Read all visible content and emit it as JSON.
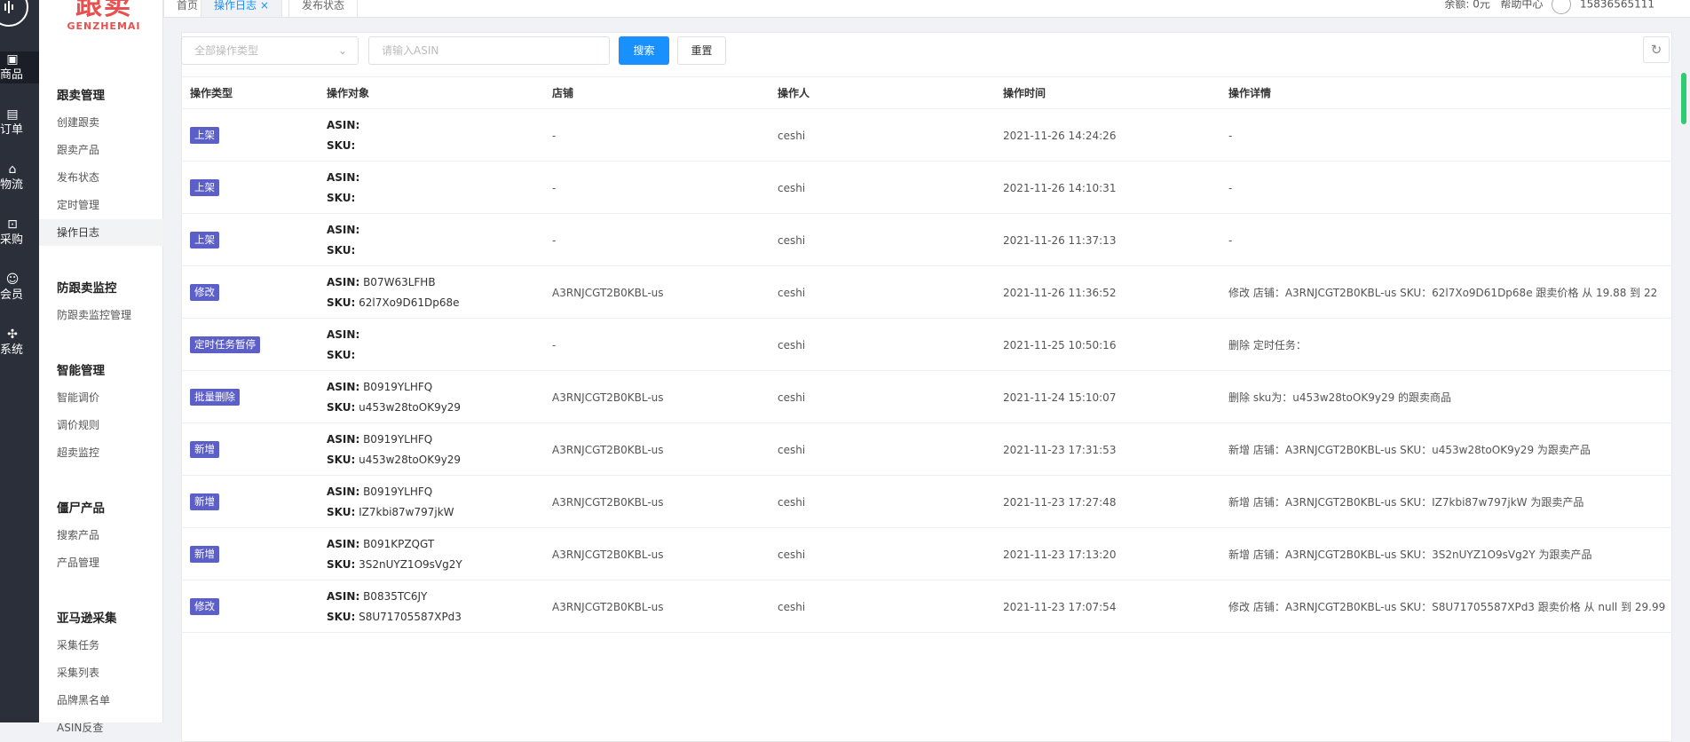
{
  "rail": {
    "items": [
      {
        "icon": "box-icon",
        "glyph": "▣",
        "label": "商品"
      },
      {
        "icon": "order-icon",
        "glyph": "▤",
        "label": "订单"
      },
      {
        "icon": "home-icon",
        "glyph": "⌂",
        "label": "物流"
      },
      {
        "icon": "cart-icon",
        "glyph": "⊡",
        "label": "采购"
      },
      {
        "icon": "user-icon",
        "glyph": "☺",
        "label": "会员"
      },
      {
        "icon": "puzzle-icon",
        "glyph": "✣",
        "label": "系统"
      }
    ]
  },
  "brand": {
    "cn": "跟卖",
    "en": "GENZHEMAI"
  },
  "sidebar": {
    "groups": [
      {
        "title": "跟卖管理",
        "items": [
          "创建跟卖",
          "跟卖产品",
          "发布状态",
          "定时管理",
          "操作日志"
        ]
      },
      {
        "title": "防跟卖监控",
        "items": [
          "防跟卖监控管理"
        ]
      },
      {
        "title": "智能管理",
        "items": [
          "智能调价",
          "调价规则",
          "超卖监控"
        ]
      },
      {
        "title": "僵尸产品",
        "items": [
          "搜索产品",
          "产品管理"
        ]
      },
      {
        "title": "亚马逊采集",
        "items": [
          "采集任务",
          "采集列表",
          "品牌黑名单",
          "ASIN反查"
        ]
      }
    ]
  },
  "tabs": [
    {
      "label": "首页"
    },
    {
      "label": "操作日志 ×"
    },
    {
      "label": "发布状态"
    }
  ],
  "topright": {
    "balance": "余额: 0元",
    "help": "帮助中心",
    "phone": "15836565111"
  },
  "filters": {
    "type_placeholder": "全部操作类型",
    "asin_placeholder": "请输入ASIN",
    "search_label": "搜索",
    "reset_label": "重置"
  },
  "table": {
    "headers": [
      "操作类型",
      "操作对象",
      "店铺",
      "操作人",
      "操作时间",
      "操作详情"
    ],
    "rows": [
      {
        "type": "上架",
        "asin": "",
        "sku": "",
        "shop": "-",
        "user": "ceshi",
        "time": "2021-11-26 14:24:26",
        "detail": "-"
      },
      {
        "type": "上架",
        "asin": "",
        "sku": "",
        "shop": "-",
        "user": "ceshi",
        "time": "2021-11-26 14:10:31",
        "detail": "-"
      },
      {
        "type": "上架",
        "asin": "",
        "sku": "",
        "shop": "-",
        "user": "ceshi",
        "time": "2021-11-26 11:37:13",
        "detail": "-"
      },
      {
        "type": "修改",
        "asin": "B07W63LFHB",
        "sku": "62l7Xo9D61Dp68e",
        "shop": "A3RNJCGT2B0KBL-us",
        "user": "ceshi",
        "time": "2021-11-26 11:36:52",
        "detail": "修改 店铺：A3RNJCGT2B0KBL-us SKU：62l7Xo9D61Dp68e 跟卖价格 从 19.88 到 22"
      },
      {
        "type": "定时任务暂停",
        "asin": "",
        "sku": "",
        "shop": "-",
        "user": "ceshi",
        "time": "2021-11-25 10:50:16",
        "detail": "删除 定时任务："
      },
      {
        "type": "批量删除",
        "asin": "B0919YLHFQ",
        "sku": "u453w28toOK9y29",
        "shop": "A3RNJCGT2B0KBL-us",
        "user": "ceshi",
        "time": "2021-11-24 15:10:07",
        "detail": "删除 sku为：u453w28toOK9y29 的跟卖商品"
      },
      {
        "type": "新增",
        "asin": "B0919YLHFQ",
        "sku": "u453w28toOK9y29",
        "shop": "A3RNJCGT2B0KBL-us",
        "user": "ceshi",
        "time": "2021-11-23 17:31:53",
        "detail": "新增 店铺：A3RNJCGT2B0KBL-us SKU：u453w28toOK9y29 为跟卖产品"
      },
      {
        "type": "新增",
        "asin": "B0919YLHFQ",
        "sku": "IZ7kbi87w797jkW",
        "shop": "A3RNJCGT2B0KBL-us",
        "user": "ceshi",
        "time": "2021-11-23 17:27:48",
        "detail": "新增 店铺：A3RNJCGT2B0KBL-us SKU：IZ7kbi87w797jkW 为跟卖产品"
      },
      {
        "type": "新增",
        "asin": "B091KPZQGT",
        "sku": "3S2nUYZ1O9sVg2Y",
        "shop": "A3RNJCGT2B0KBL-us",
        "user": "ceshi",
        "time": "2021-11-23 17:13:20",
        "detail": "新增 店铺：A3RNJCGT2B0KBL-us SKU：3S2nUYZ1O9sVg2Y 为跟卖产品"
      },
      {
        "type": "修改",
        "asin": "B0835TC6JY",
        "sku": "S8U71705587XPd3",
        "shop": "A3RNJCGT2B0KBL-us",
        "user": "ceshi",
        "time": "2021-11-23 17:07:54",
        "detail": "修改 店铺：A3RNJCGT2B0KBL-us SKU：S8U71705587XPd3 跟卖价格 从 null 到 29.99"
      }
    ]
  },
  "labels": {
    "asin": "ASIN:",
    "sku": "SKU:"
  }
}
